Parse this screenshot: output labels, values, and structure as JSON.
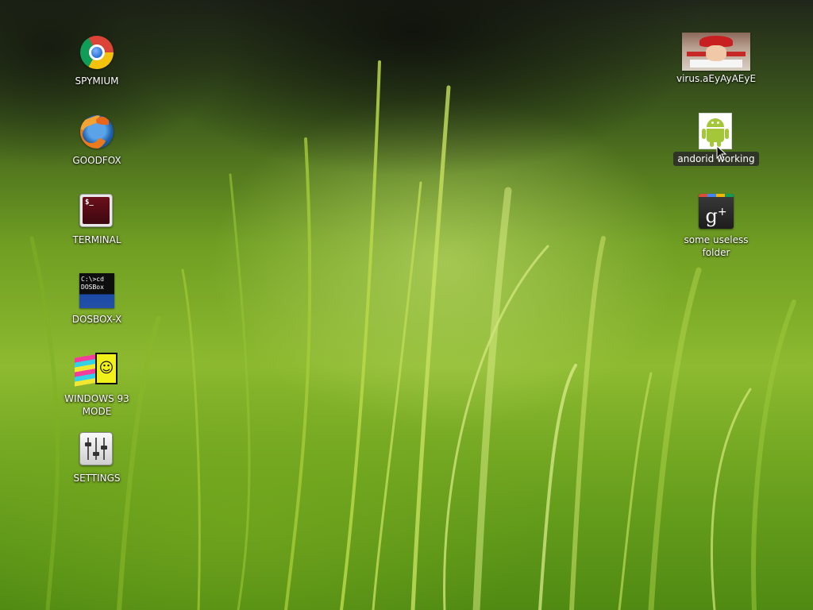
{
  "desktop": {
    "left_icons": [
      {
        "name": "chrome",
        "label": "SPYMIUM"
      },
      {
        "name": "firefox",
        "label": "GOODFOX"
      },
      {
        "name": "terminal",
        "label": "TERMINAL",
        "glyph": "$_"
      },
      {
        "name": "dosbox",
        "label": "DOSBOX-X",
        "glyph_line1": "C:\\>cd",
        "glyph_line2": "DOSBox"
      },
      {
        "name": "windows93",
        "label": "WINDOWS 93\nMODE",
        "glyph": "☺"
      },
      {
        "name": "settings",
        "label": "SETTINGS"
      }
    ],
    "right_icons": [
      {
        "name": "virus",
        "label": "virus.aEyAyAEyE"
      },
      {
        "name": "android",
        "label": "andorid working",
        "selected": true
      },
      {
        "name": "gplus",
        "label": "some useless\nfolder",
        "glyph": "g",
        "glyph_sup": "+"
      }
    ]
  },
  "colors": {
    "wallpaper_green": "#6f9e22",
    "android_green": "#a4c639",
    "selection_bg": "#282828"
  }
}
